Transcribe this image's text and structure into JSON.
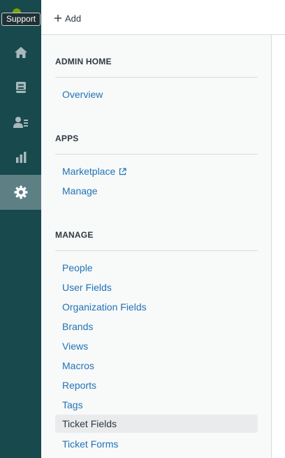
{
  "rail": {
    "tooltip": "Support",
    "items": [
      {
        "icon": "home-icon"
      },
      {
        "icon": "views-icon"
      },
      {
        "icon": "customers-icon"
      },
      {
        "icon": "reporting-icon"
      },
      {
        "icon": "admin-gear-icon",
        "active": true
      }
    ]
  },
  "topbar": {
    "add_label": "Add"
  },
  "nav": {
    "admin_home": {
      "title": "ADMIN HOME",
      "items": [
        "Overview"
      ]
    },
    "apps": {
      "title": "APPS",
      "items": [
        "Marketplace",
        "Manage"
      ]
    },
    "manage": {
      "title": "MANAGE",
      "items": [
        "People",
        "User Fields",
        "Organization Fields",
        "Brands",
        "Views",
        "Macros",
        "Reports",
        "Tags",
        "Ticket Fields",
        "Ticket Forms"
      ],
      "selected": "Ticket Fields"
    }
  },
  "colors": {
    "rail_bg": "#17494d",
    "rail_active": "#5d8085",
    "link": "#1f73b7",
    "text": "#2f3941"
  }
}
